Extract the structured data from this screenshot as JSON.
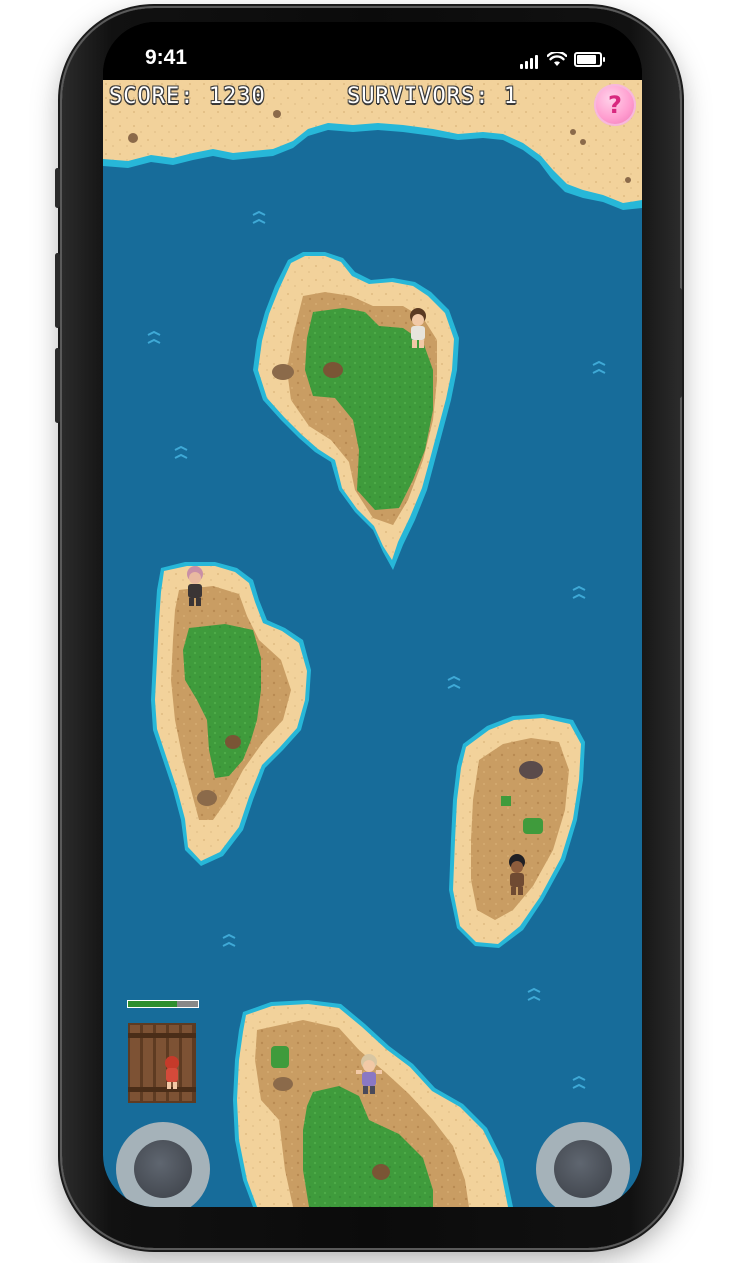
{
  "status_bar": {
    "time": "9:41",
    "icons": [
      "cellular-signal-icon",
      "wifi-icon",
      "battery-icon"
    ]
  },
  "hud": {
    "score_text": "SCORE: 1230",
    "survivors_text": "SURVIVORS: 1",
    "help_icon": "question-mark-icon",
    "help_symbol": "?"
  },
  "player": {
    "health_fraction": 0.7
  },
  "controls": {
    "left_joystick": "movement-joystick",
    "right_joystick": "action-joystick"
  },
  "colors": {
    "water": "#176c9a",
    "sand": "#f2d29b",
    "dirt": "#c79a60",
    "grass": "#3f9b3c",
    "foam": "#27b7d8",
    "health": "#2e8f2e"
  }
}
